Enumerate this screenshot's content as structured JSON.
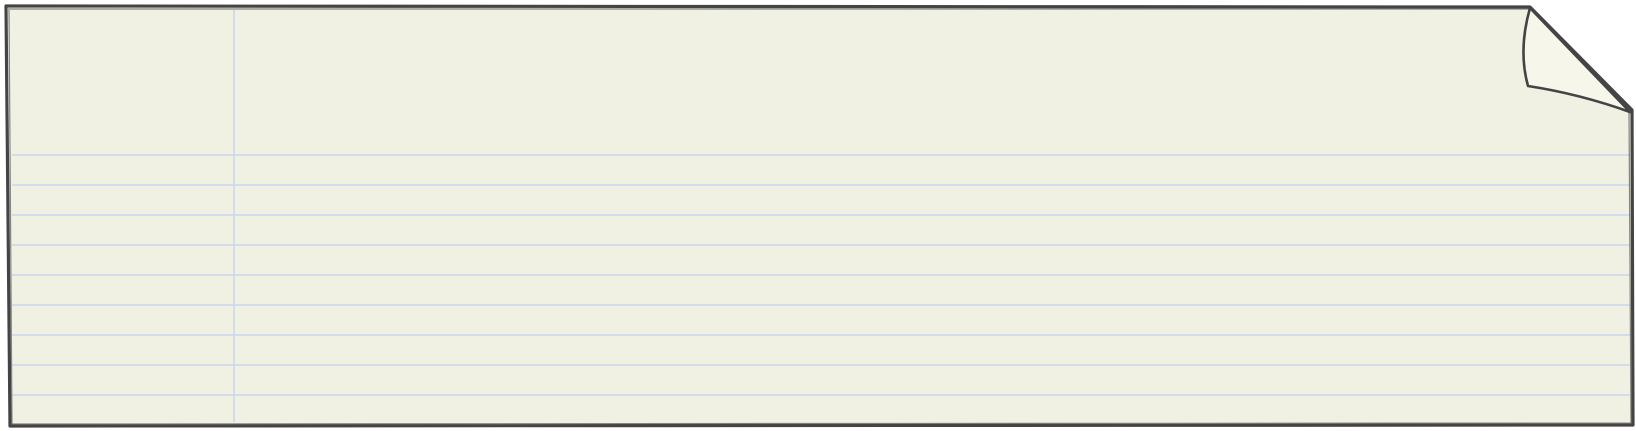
{
  "note": {
    "paper_color": "#f0f0e3",
    "fold_color": "#f6f6ea",
    "rule_line_color": "#c9d6ee",
    "margin_line_color": "#c9d6ee",
    "outline_color": "#444444",
    "ruled_line_count": 9,
    "text_lines": []
  }
}
